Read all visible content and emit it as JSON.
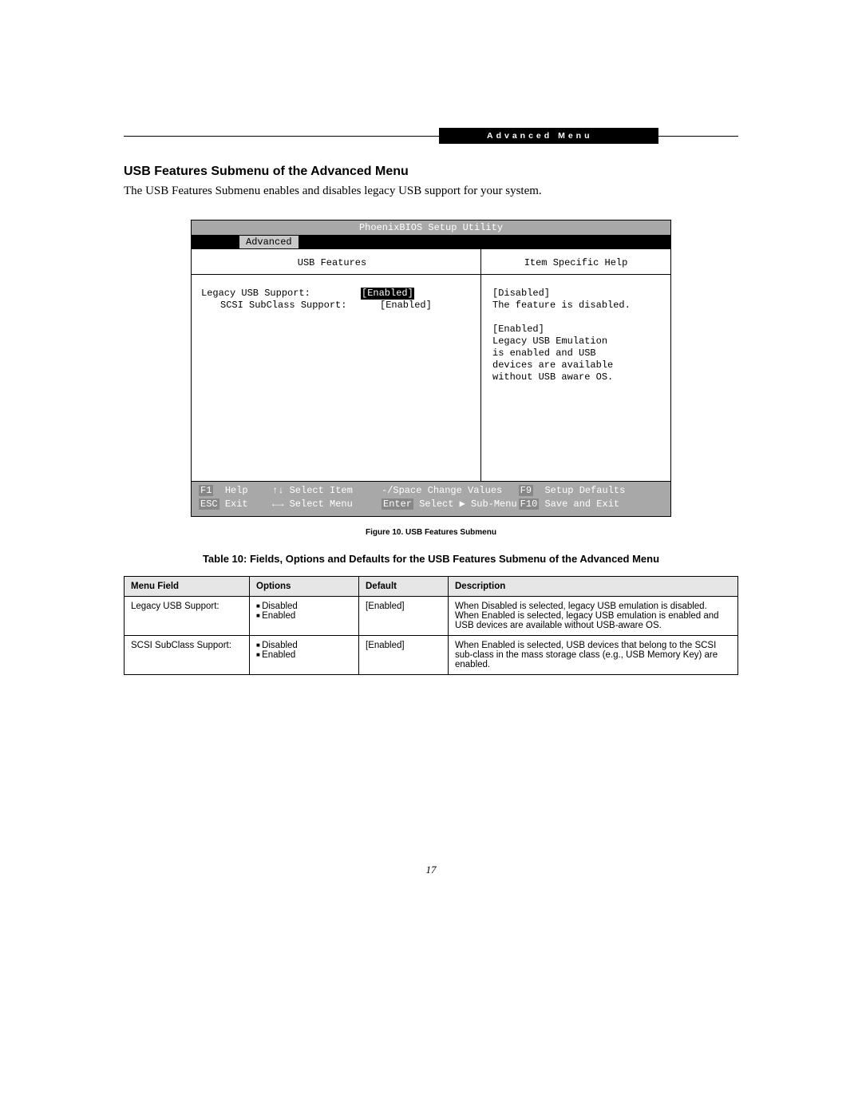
{
  "header_bar": "Advanced Menu",
  "section_title": "USB Features Submenu of the Advanced Menu",
  "intro": "The USB Features Submenu enables and disables legacy USB support for your system.",
  "bios": {
    "title": "PhoenixBIOS Setup Utility",
    "menu_tab": "Advanced",
    "left_title": "USB Features",
    "right_title": "Item Specific Help",
    "rows": [
      {
        "label": "Legacy USB Support:",
        "value": "[Enabled]",
        "selected": true
      },
      {
        "label": "SCSI SubClass Support:",
        "value": "[Enabled]",
        "selected": false
      }
    ],
    "help": {
      "l1": "[Disabled]",
      "l2": "The feature is disabled.",
      "l3": "[Enabled]",
      "l4": "Legacy USB Emulation",
      "l5": "is enabled and USB",
      "l6": "devices are available",
      "l7": "without USB aware OS."
    },
    "footer": {
      "f1": "F1",
      "help": "Help",
      "sel_item": "Select Item",
      "space": "-/Space",
      "change": "Change Values",
      "f9": "F9",
      "defaults": "Setup Defaults",
      "esc": "ESC",
      "exit": "Exit",
      "sel_menu": "Select Menu",
      "enter": "Enter",
      "submenu": "Select ▶ Sub-Menu",
      "f10": "F10",
      "save": "Save and Exit"
    }
  },
  "figure_caption": "Figure 10.  USB Features Submenu",
  "table_title": "Table 10: Fields, Options and Defaults for the USB Features Submenu of the Advanced Menu",
  "table": {
    "headers": [
      "Menu Field",
      "Options",
      "Default",
      "Description"
    ],
    "rows": [
      {
        "field": "Legacy USB Support:",
        "options": [
          "Disabled",
          "Enabled"
        ],
        "default": "[Enabled]",
        "desc": "When Disabled is selected, legacy USB emulation is disabled. When Enabled is selected, legacy USB emulation is enabled and USB devices are available without USB-aware OS."
      },
      {
        "field": "SCSI SubClass Support:",
        "options": [
          "Disabled",
          "Enabled"
        ],
        "default": "[Enabled]",
        "desc": "When Enabled is selected, USB devices that belong to the SCSI sub-class in the mass storage class (e.g., USB Memory Key) are enabled."
      }
    ]
  },
  "page_number": "17"
}
